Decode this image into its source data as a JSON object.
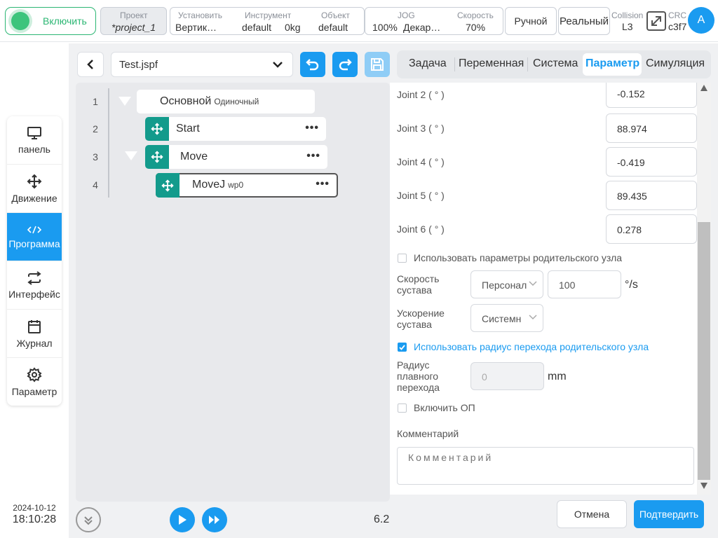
{
  "colors": {
    "accent": "#1a9bf0",
    "enable_green": "#2bb673",
    "node_teal": "#139b8c"
  },
  "topbar": {
    "enable_label": "Включить",
    "project": {
      "caption": "Проект",
      "value": "*project_1"
    },
    "install": {
      "caption": "Установить",
      "value": "Вертик…"
    },
    "tool": {
      "caption": "Инструмент",
      "value_name": "default",
      "value_load": "0kg"
    },
    "object": {
      "caption": "Объект",
      "value": "default"
    },
    "jog": {
      "caption": "JOG",
      "value_pct": "100%",
      "value_frame": "Декар…"
    },
    "speed": {
      "caption": "Скорость",
      "value": "70%"
    },
    "manual_label": "Ручной",
    "real_label": "Реальный",
    "collision": {
      "caption": "Collision",
      "value": "L3"
    },
    "expand_icon": "expand-icon",
    "crc": {
      "caption": "CRC",
      "value": "c3f7"
    },
    "avatar_letter": "A"
  },
  "sidenav": {
    "items": [
      {
        "label": "панель",
        "icon": "monitor-icon"
      },
      {
        "label": "Движение",
        "icon": "move-icon"
      },
      {
        "label": "Программа",
        "icon": "code-icon",
        "active": true
      },
      {
        "label": "Интерфейс",
        "icon": "swap-icon"
      },
      {
        "label": "Журнал",
        "icon": "calendar-icon"
      },
      {
        "label": "Параметр",
        "icon": "gear-icon"
      }
    ],
    "date": "2024-10-12",
    "time": "18:10:28"
  },
  "editor": {
    "file_name": "Test.jspf",
    "line_numbers": [
      "1",
      "2",
      "3",
      "4"
    ],
    "tree": [
      {
        "name": "Основной",
        "sub": "Одиночный"
      },
      {
        "name": "Start",
        "sub": ""
      },
      {
        "name": "Move",
        "sub": ""
      },
      {
        "name": "MoveJ",
        "sub": "wp0"
      }
    ],
    "more_glyph": "•••",
    "version": "6.2"
  },
  "tabs": [
    "Задача",
    "Переменная",
    "Система",
    "Параметр",
    "Симуляция"
  ],
  "active_tab": "Параметр",
  "params": {
    "joints": [
      {
        "label": "Joint 2 ( ° )",
        "value": "-0.152"
      },
      {
        "label": "Joint 3 ( ° )",
        "value": "88.974"
      },
      {
        "label": "Joint 4 ( ° )",
        "value": "-0.419"
      },
      {
        "label": "Joint 5 ( ° )",
        "value": "89.435"
      },
      {
        "label": "Joint 6 ( ° )",
        "value": "0.278"
      }
    ],
    "use_parent_params": {
      "label": "Использовать параметры родительского узла",
      "checked": false
    },
    "joint_speed": {
      "label_line1": "Скорость",
      "label_line2": "сустава",
      "mode": "Персонал",
      "value": "100",
      "unit": "°/s"
    },
    "joint_accel": {
      "label_line1": "Ускорение",
      "label_line2": "сустава",
      "mode": "Системн"
    },
    "use_parent_radius": {
      "label": "Использовать радиус перехода родительского узла",
      "checked": true
    },
    "blend_radius": {
      "label_line1": "Радиус",
      "label_line2": "плавного",
      "label_line3": "перехода",
      "value": "0",
      "unit": "mm"
    },
    "enable_op": {
      "label": "Включить ОП",
      "checked": false
    },
    "comment": {
      "label": "Комментарий",
      "placeholder": "Комментарий"
    }
  },
  "actions": {
    "cancel": "Отмена",
    "confirm": "Подтвердить"
  }
}
